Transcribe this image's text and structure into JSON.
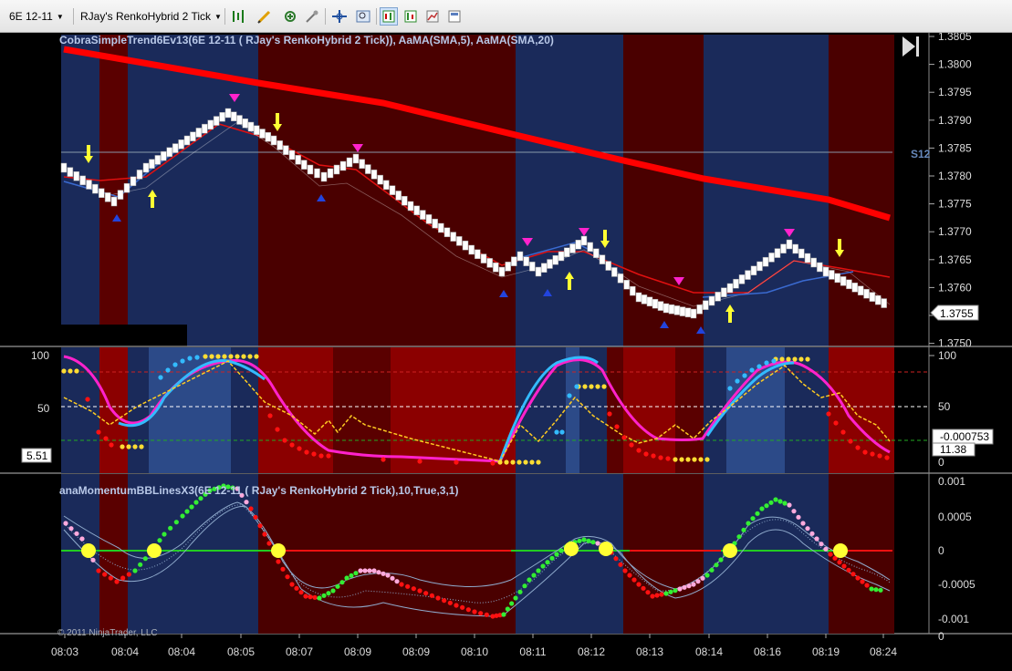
{
  "toolbar": {
    "instrument": "6E 12-11",
    "bar_type": "RJay's RenkoHybrid  2 Tick",
    "buttons": [
      {
        "name": "bar-style-icon"
      },
      {
        "name": "draw-tool-icon"
      },
      {
        "name": "zoom-in-icon"
      },
      {
        "name": "properties-icon"
      },
      {
        "name": "crosshair-icon"
      },
      {
        "name": "magnify-icon"
      },
      {
        "name": "data-box-icon"
      },
      {
        "name": "indicators-icon"
      },
      {
        "name": "strategies-icon"
      },
      {
        "name": "templates-icon"
      }
    ]
  },
  "panel1": {
    "title": "CobraSimpleTrend6Ev13(6E 12-11 ( RJay's RenkoHybrid  2 Tick)), AaMA(SMA,5), AaMA(SMA,20)",
    "side_label": "S12",
    "price_ticks": [
      "1.3805",
      "1.3800",
      "1.3795",
      "1.3790",
      "1.3785",
      "1.3780",
      "1.3775",
      "1.3770",
      "1.3765",
      "1.3760",
      "1.3755",
      "1.3750"
    ],
    "last_price": "1.3755"
  },
  "panel2": {
    "ticks": [
      "100",
      "50",
      "0"
    ],
    "left_value": "5.51",
    "right_values": [
      "50",
      "-0.000753",
      "11.38",
      "0"
    ],
    "right_tick_50": "50",
    "right_tick_0": "0"
  },
  "panel3": {
    "title": "anaMomentumBBLinesX3(6E 12-11 ( RJay's RenkoHybrid  2 Tick),10,True,3,1)",
    "ticks": [
      "0.001",
      "0.0005",
      "0",
      "-0.0005",
      "-0.001",
      "0"
    ],
    "copyright": "© 2011 NinjaTrader, LLC"
  },
  "time_axis": [
    "08:03",
    "08:04",
    "08:04",
    "08:05",
    "08:07",
    "08:09",
    "08:09",
    "08:10",
    "08:11",
    "08:12",
    "08:13",
    "08:14",
    "08:16",
    "08:19",
    "08:24"
  ],
  "colors": {
    "up_zone": "#1a2a5a",
    "down_zone": "#4a0000",
    "bright_red": "#8b0000",
    "sma20": "#ff0000",
    "sma5": "#e01010",
    "magenta": "#ff00cc",
    "cyan": "#33bbff",
    "yellow": "#ffff33"
  }
}
